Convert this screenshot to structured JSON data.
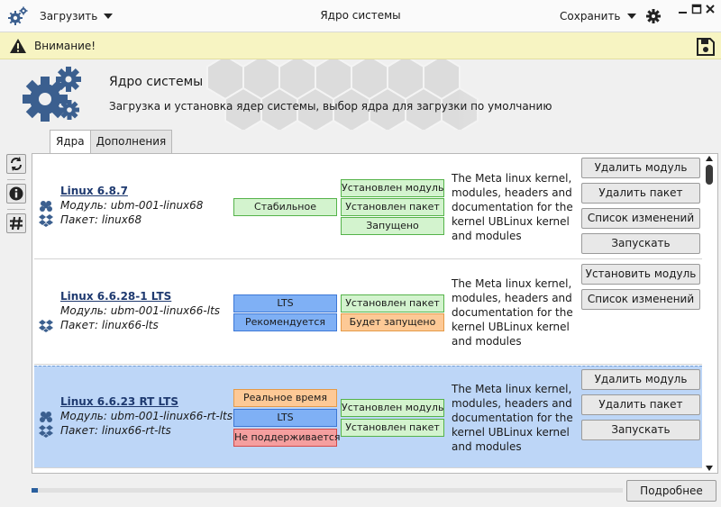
{
  "titlebar": {
    "load_label": "Загрузить",
    "title": "Ядро системы",
    "save_label": "Сохранить"
  },
  "warning": {
    "text": "Внимание!"
  },
  "header": {
    "title": "Ядро системы",
    "subtitle": "Загрузка и установка ядер системы, выбор ядра для загрузки по умолчанию"
  },
  "tabs": [
    {
      "label": "Ядра",
      "active": true
    },
    {
      "label": "Дополнения",
      "active": false
    }
  ],
  "kernels": [
    {
      "name": "Linux 6.8.7",
      "module": "Модуль: ubm-001-linux68",
      "package": "Пакет: linux68",
      "left_badges": [
        {
          "label": "Стабильное",
          "color": "green"
        }
      ],
      "right_badges": [
        {
          "label": "Установлен модуль",
          "color": "green"
        },
        {
          "label": "Установлен пакет",
          "color": "green"
        },
        {
          "label": "Запущено",
          "color": "green"
        }
      ],
      "description": "The Meta linux kernel, modules, headers and documentation for the kernel UBLinux kernel and modules",
      "actions": [
        "Удалить модуль",
        "Удалить пакет",
        "Список изменений",
        "Запускать"
      ]
    },
    {
      "name": "Linux 6.6.28-1 LTS",
      "module": "Модуль: ubm-001-linux66-lts",
      "package": "Пакет: linux66-lts",
      "left_badges": [
        {
          "label": "LTS",
          "color": "blue"
        },
        {
          "label": "Рекомендуется",
          "color": "blue"
        }
      ],
      "right_badges": [
        {
          "label": "Установлен пакет",
          "color": "green"
        },
        {
          "label": "Будет запущено",
          "color": "orange"
        }
      ],
      "description": "The Meta linux kernel, modules, headers and documentation for the kernel UBLinux kernel and modules",
      "actions": [
        "Установить модуль",
        "Список изменений"
      ]
    },
    {
      "name": "Linux 6.6.23 RT LTS",
      "module": "Модуль: ubm-001-linux66-rt-lts",
      "package": "Пакет: linux66-rt-lts",
      "left_badges": [
        {
          "label": "Реальное время",
          "color": "orange"
        },
        {
          "label": "LTS",
          "color": "blue"
        },
        {
          "label": "Не поддерживается",
          "color": "red"
        }
      ],
      "right_badges": [
        {
          "label": "Установлен модуль",
          "color": "green"
        },
        {
          "label": "Установлен пакет",
          "color": "green"
        }
      ],
      "description": "The Meta linux kernel, modules, headers and documentation for the kernel UBLinux kernel and modules",
      "actions": [
        "Удалить модуль",
        "Удалить пакет",
        "Запускать"
      ]
    }
  ],
  "icons": {
    "app": "gears-icon",
    "settings": "gear-icon",
    "warning": "warning-icon",
    "save": "floppy-disk-icon",
    "refresh": "refresh-icon",
    "info": "info-icon",
    "hash": "hash-icon",
    "module": "module-icon",
    "package": "dropbox-icon"
  },
  "colors": {
    "green": "#d3f3ce",
    "blue": "#7fb0f5",
    "orange": "#fdc996",
    "red": "#f59f9f",
    "selected_row": "#bdd6f7",
    "warning_bar": "#f7f4c2",
    "progress": "#2a5f9e"
  },
  "progress": {
    "fraction": 0.01
  },
  "details_label": "Подробнее"
}
